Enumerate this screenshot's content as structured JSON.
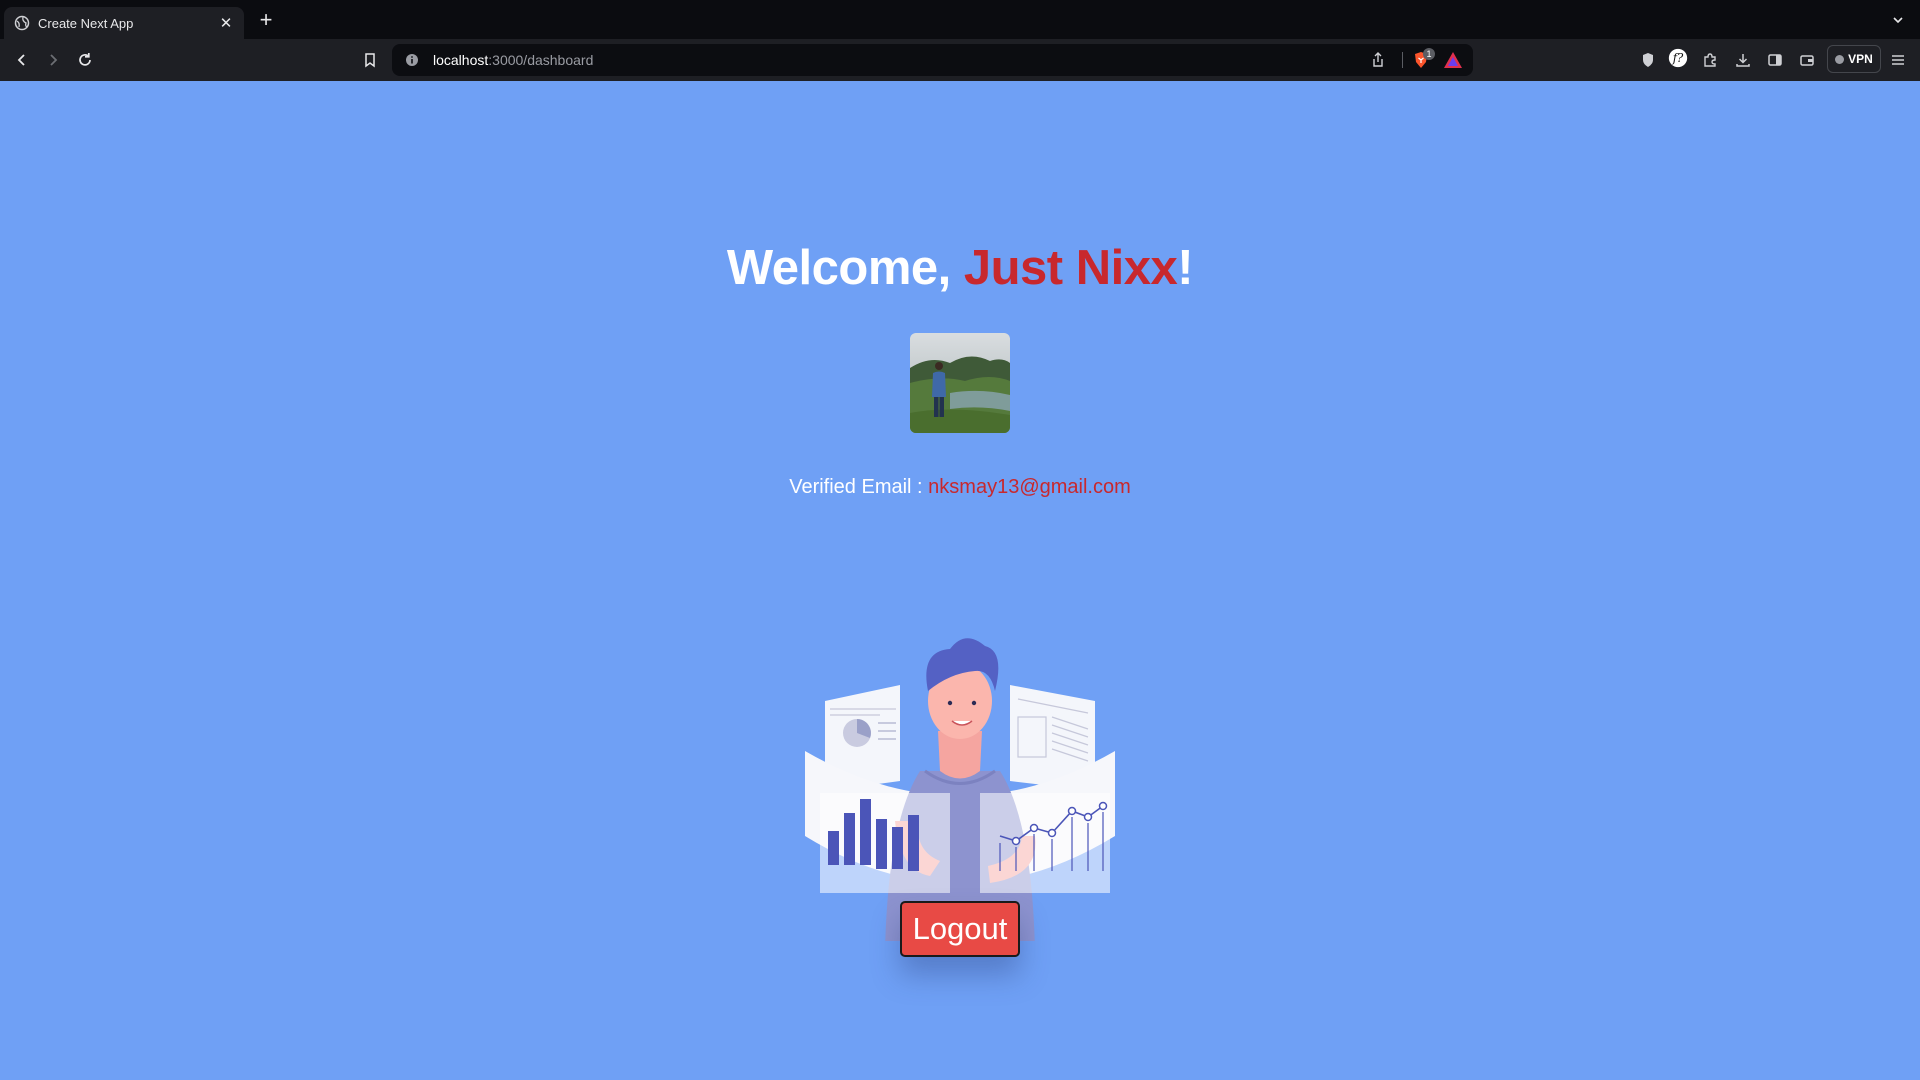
{
  "browser": {
    "tab": {
      "title": "Create Next App",
      "close_icon": "close-icon",
      "favicon": "globe-icon"
    },
    "new_tab_label": "+",
    "url": {
      "host": "localhost",
      "path": ":3000/dashboard"
    },
    "brave_shields_count": "1",
    "vpn_label": "VPN"
  },
  "page": {
    "welcome_prefix": "Welcome, ",
    "user_name": "Just Nixx",
    "welcome_suffix": "!",
    "email_label": "Verified Email : ",
    "email": "nksmay13@gmail.com",
    "logout_label": "Logout"
  },
  "colors": {
    "page_background": "#6fa0f5",
    "accent_red": "#c8282d",
    "button_red": "#e84a45"
  }
}
